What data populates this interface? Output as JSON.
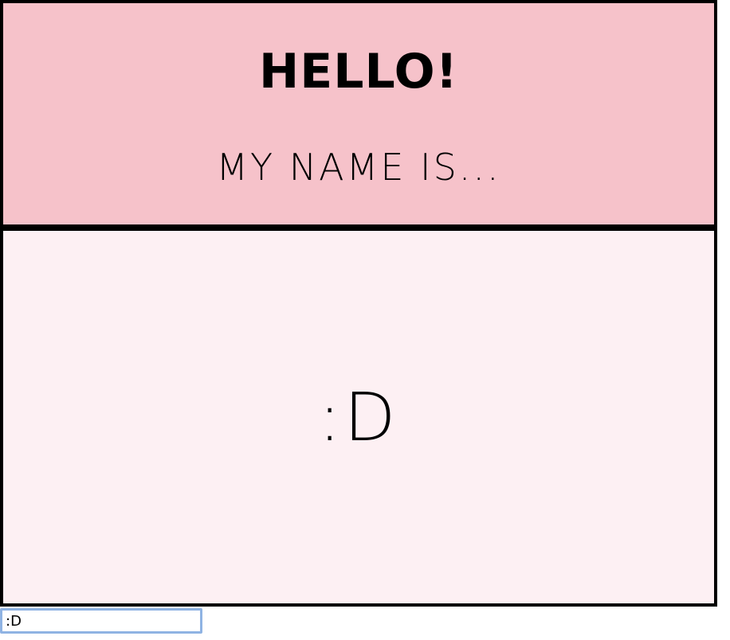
{
  "badge": {
    "greeting": "HELLO!",
    "subtitle": "MY NAME IS...",
    "name_value": ":D",
    "colors": {
      "header_bg": "#f6c2ca",
      "body_bg": "#fdf0f3",
      "border": "#000000",
      "input_focus": "#8fb3e3"
    }
  },
  "input": {
    "value": ":D"
  }
}
